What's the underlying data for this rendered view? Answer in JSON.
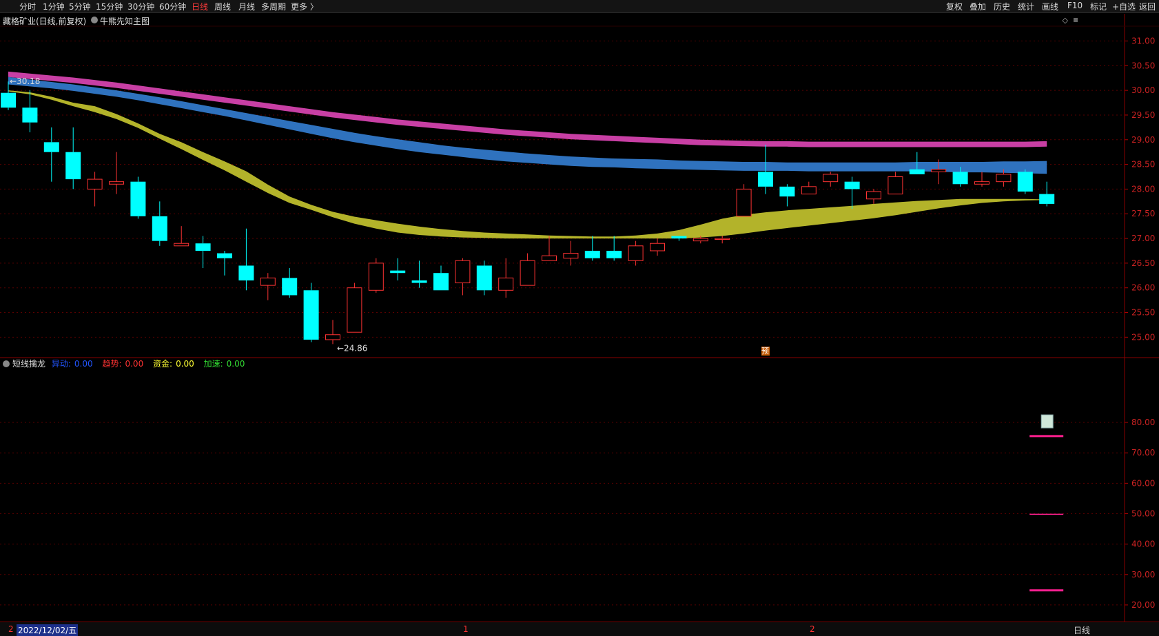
{
  "toolbar": {
    "left_items": [
      "分时",
      "1分钟",
      "5分钟",
      "15分钟",
      "30分钟",
      "60分钟",
      "日线",
      "周线",
      "月线",
      "多周期",
      "更多 〉"
    ],
    "active": "日线",
    "right_items": [
      "复权",
      "叠加",
      "历史",
      "统计",
      "画线",
      "F10",
      "标记",
      "+自选",
      "返回"
    ]
  },
  "header": {
    "stock": "藏格矿业(日线,前复权)",
    "main_indicator": "牛熊先知主图"
  },
  "sub_indicator": {
    "name": "短线擒龙",
    "fields": [
      {
        "label": "异动:",
        "value": "0.00",
        "color": "#2255ff"
      },
      {
        "label": "趋势:",
        "value": "0.00",
        "color": "#ff3333"
      },
      {
        "label": "资金:",
        "value": "0.00",
        "color": "#ffff33"
      },
      {
        "label": "加速:",
        "value": "0.00",
        "color": "#33dd33"
      }
    ]
  },
  "annotations": {
    "high": "30.18",
    "low": "24.86",
    "flag": "预"
  },
  "bottom": {
    "date": "2022/12/02/五",
    "tab": "日线",
    "axis_marks": [
      "2",
      "1",
      "2"
    ]
  },
  "chart_data": [
    {
      "type": "candlestick",
      "ylim": [
        24.6,
        31.3
      ],
      "yticks": [
        "25.00",
        "25.50",
        "26.00",
        "26.50",
        "27.00",
        "27.50",
        "28.00",
        "28.50",
        "29.00",
        "29.50",
        "30.00",
        "30.50",
        "31.00"
      ],
      "colors": {
        "up": "#ff3333",
        "down": "#00ffff",
        "band1": "#c83fa4",
        "band2": "#2f72be",
        "band3": "#b3b32a"
      },
      "candles": [
        [
          29.95,
          29.65,
          30.18,
          29.6
        ],
        [
          29.65,
          29.35,
          30.0,
          29.15
        ],
        [
          28.95,
          28.75,
          29.25,
          28.15
        ],
        [
          28.75,
          28.2,
          29.25,
          28.0
        ],
        [
          28.0,
          28.2,
          28.35,
          27.65
        ],
        [
          28.1,
          28.15,
          28.75,
          27.9
        ],
        [
          28.15,
          27.45,
          28.25,
          27.4
        ],
        [
          27.45,
          26.95,
          27.75,
          26.85
        ],
        [
          26.85,
          26.9,
          27.25,
          26.85
        ],
        [
          26.9,
          26.75,
          27.05,
          26.4
        ],
        [
          26.7,
          26.6,
          26.75,
          26.25
        ],
        [
          26.45,
          26.15,
          27.2,
          25.95
        ],
        [
          26.05,
          26.2,
          26.3,
          25.75
        ],
        [
          26.2,
          25.85,
          26.4,
          25.8
        ],
        [
          25.95,
          24.95,
          26.1,
          24.9
        ],
        [
          24.95,
          25.05,
          25.35,
          24.86
        ],
        [
          25.1,
          26.0,
          26.1,
          25.1
        ],
        [
          25.95,
          26.5,
          26.6,
          25.9
        ],
        [
          26.35,
          26.3,
          26.6,
          26.15
        ],
        [
          26.15,
          26.1,
          26.55,
          26.0
        ],
        [
          26.3,
          25.95,
          26.45,
          25.95
        ],
        [
          26.1,
          26.55,
          26.6,
          25.85
        ],
        [
          26.45,
          25.95,
          26.55,
          25.85
        ],
        [
          25.95,
          26.2,
          26.6,
          25.8
        ],
        [
          26.05,
          26.55,
          26.7,
          26.05
        ],
        [
          26.55,
          26.65,
          27.05,
          26.55
        ],
        [
          26.6,
          26.7,
          26.95,
          26.45
        ],
        [
          26.75,
          26.6,
          27.05,
          26.55
        ],
        [
          26.75,
          26.6,
          27.05,
          26.55
        ],
        [
          26.55,
          26.85,
          26.95,
          26.45
        ],
        [
          26.75,
          26.9,
          27.0,
          26.65
        ],
        [
          27.05,
          27.0,
          27.05,
          26.95
        ],
        [
          26.95,
          27.0,
          27.05,
          26.9
        ],
        [
          27.0,
          27.0,
          27.05,
          26.9
        ],
        [
          27.45,
          28.0,
          28.1,
          27.45
        ],
        [
          28.35,
          28.05,
          28.9,
          27.9
        ],
        [
          28.05,
          27.85,
          28.1,
          27.65
        ],
        [
          27.9,
          28.05,
          28.15,
          27.9
        ],
        [
          28.15,
          28.3,
          28.35,
          28.05
        ],
        [
          28.15,
          28.0,
          28.25,
          27.6
        ],
        [
          27.8,
          27.95,
          28.0,
          27.7
        ],
        [
          27.9,
          28.25,
          28.35,
          27.9
        ],
        [
          28.4,
          28.3,
          28.75,
          28.3
        ],
        [
          28.35,
          28.4,
          28.6,
          28.1
        ],
        [
          28.35,
          28.1,
          28.45,
          28.05
        ],
        [
          28.1,
          28.15,
          28.35,
          28.05
        ],
        [
          28.15,
          28.3,
          28.4,
          28.05
        ],
        [
          28.35,
          27.95,
          28.4,
          27.9
        ],
        [
          27.9,
          27.7,
          28.15,
          27.65
        ]
      ],
      "bands": {
        "band1_top": [
          30.38,
          30.34,
          30.3,
          30.26,
          30.21,
          30.16,
          30.1,
          30.04,
          29.98,
          29.92,
          29.86,
          29.8,
          29.74,
          29.68,
          29.62,
          29.56,
          29.51,
          29.46,
          29.41,
          29.37,
          29.33,
          29.29,
          29.25,
          29.21,
          29.18,
          29.15,
          29.12,
          29.1,
          29.08,
          29.06,
          29.04,
          29.02,
          29.0,
          28.99,
          28.98,
          28.97,
          28.97,
          28.96,
          28.96,
          28.96,
          28.96,
          28.96,
          28.96,
          28.96,
          28.96,
          28.96,
          28.96,
          28.96,
          28.97
        ],
        "band1_bot": [
          30.27,
          30.23,
          30.19,
          30.15,
          30.1,
          30.05,
          29.99,
          29.93,
          29.87,
          29.81,
          29.75,
          29.69,
          29.63,
          29.57,
          29.51,
          29.45,
          29.4,
          29.35,
          29.3,
          29.26,
          29.22,
          29.18,
          29.14,
          29.1,
          29.07,
          29.04,
          29.01,
          28.99,
          28.97,
          28.95,
          28.93,
          28.91,
          28.89,
          28.88,
          28.87,
          28.86,
          28.86,
          28.85,
          28.85,
          28.85,
          28.85,
          28.85,
          28.85,
          28.85,
          28.85,
          28.85,
          28.85,
          28.85,
          28.86
        ],
        "band2_top": [
          30.27,
          30.22,
          30.17,
          30.12,
          30.06,
          30.0,
          29.93,
          29.86,
          29.78,
          29.7,
          29.62,
          29.54,
          29.46,
          29.38,
          29.3,
          29.22,
          29.14,
          29.07,
          29.01,
          28.95,
          28.89,
          28.84,
          28.8,
          28.76,
          28.72,
          28.69,
          28.66,
          28.64,
          28.62,
          28.61,
          28.6,
          28.58,
          28.57,
          28.56,
          28.55,
          28.55,
          28.54,
          28.54,
          28.54,
          28.54,
          28.54,
          28.54,
          28.55,
          28.55,
          28.55,
          28.55,
          28.56,
          28.56,
          28.57
        ],
        "band2_bot": [
          30.12,
          30.08,
          30.04,
          29.99,
          29.93,
          29.87,
          29.8,
          29.72,
          29.64,
          29.56,
          29.48,
          29.39,
          29.3,
          29.21,
          29.12,
          29.03,
          28.95,
          28.88,
          28.81,
          28.75,
          28.7,
          28.65,
          28.6,
          28.56,
          28.53,
          28.5,
          28.47,
          28.45,
          28.44,
          28.42,
          28.41,
          28.4,
          28.39,
          28.38,
          28.37,
          28.37,
          28.37,
          28.36,
          28.36,
          28.36,
          28.36,
          28.36,
          28.36,
          28.35,
          28.34,
          28.34,
          28.33,
          28.32,
          28.31
        ],
        "band3_top": [
          30.0,
          29.96,
          29.87,
          29.75,
          29.68,
          29.52,
          29.33,
          29.12,
          28.95,
          28.75,
          28.56,
          28.36,
          28.09,
          27.85,
          27.68,
          27.54,
          27.44,
          27.37,
          27.3,
          27.24,
          27.19,
          27.15,
          27.12,
          27.1,
          27.08,
          27.06,
          27.05,
          27.04,
          27.04,
          27.06,
          27.1,
          27.17,
          27.28,
          27.4,
          27.48,
          27.53,
          27.57,
          27.6,
          27.63,
          27.66,
          27.7,
          27.73,
          27.76,
          27.78,
          27.8,
          27.8,
          27.8,
          27.8,
          27.79
        ],
        "band3_bot": [
          29.98,
          29.92,
          29.81,
          29.68,
          29.56,
          29.42,
          29.24,
          29.02,
          28.81,
          28.59,
          28.38,
          28.15,
          27.92,
          27.72,
          27.58,
          27.43,
          27.3,
          27.2,
          27.12,
          27.07,
          27.04,
          27.02,
          27.01,
          27.0,
          27.0,
          27.0,
          27.0,
          27.0,
          27.0,
          27.0,
          27.0,
          27.0,
          27.02,
          27.05,
          27.1,
          27.16,
          27.21,
          27.26,
          27.31,
          27.36,
          27.41,
          27.47,
          27.54,
          27.61,
          27.67,
          27.72,
          27.75,
          27.77,
          27.78
        ]
      }
    },
    {
      "type": "indicator",
      "ylim": [
        15,
        97
      ],
      "yticks": [
        "20.00",
        "30.00",
        "40.00",
        "50.00",
        "60.00",
        "70.00",
        "80.00"
      ],
      "levels": [
        75.5,
        49.8,
        24.8
      ],
      "marker_value": 80.0
    }
  ]
}
